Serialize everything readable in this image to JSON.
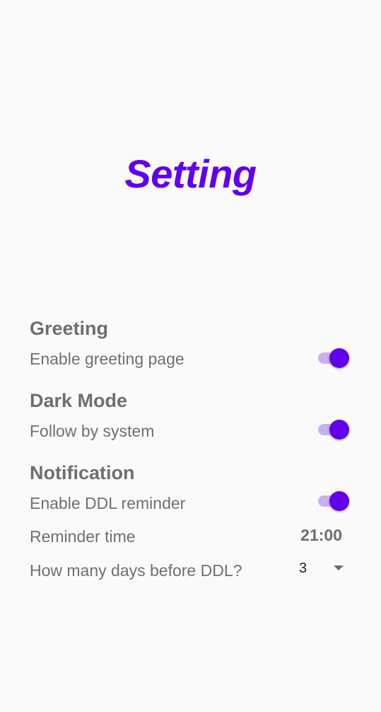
{
  "page": {
    "title": "Setting"
  },
  "colors": {
    "accent": "#6200ee",
    "track": "#c7b0f2",
    "background": "#fafafa",
    "text": "#707070"
  },
  "sections": {
    "greeting": {
      "title": "Greeting",
      "enable_label": "Enable greeting page",
      "enable_on": true
    },
    "dark_mode": {
      "title": "Dark Mode",
      "follow_label": "Follow by system",
      "follow_on": true
    },
    "notification": {
      "title": "Notification",
      "reminder_label": "Enable DDL reminder",
      "reminder_on": true,
      "time_label": "Reminder time",
      "time_value": "21:00",
      "days_label": "How many days before DDL?",
      "days_value": "3",
      "days_icon": "dropdown-arrow-icon"
    }
  }
}
